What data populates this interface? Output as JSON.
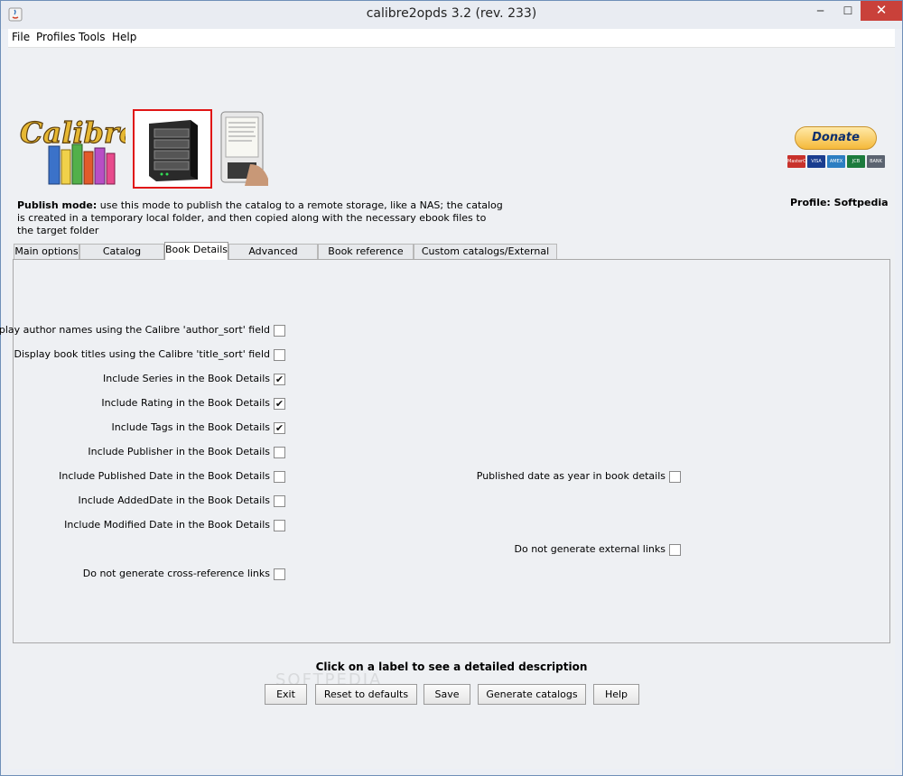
{
  "window": {
    "title": "calibre2opds 3.2 (rev. 233)",
    "minimize": "─",
    "maximize": "☐",
    "close": "✕"
  },
  "menu": [
    "File",
    "Profiles",
    "Tools",
    "Help"
  ],
  "header": {
    "logo_text": "Calibre",
    "donate": "Donate",
    "cards": [
      "MasterCard",
      "VISA",
      "AMEX",
      "JCB",
      "BANK"
    ],
    "profile": "Profile: Softpedia",
    "publish_mode_label": "Publish mode:",
    "publish_mode_text": "use this mode to publish the catalog to a remote storage, like a NAS; the catalog is created in a temporary local folder, and then copied along with the necessary ebook files to the target folder"
  },
  "tabs": [
    "Main options",
    "Catalog Structure",
    "Book Details",
    "Advanced Options",
    "Book reference links",
    "Custom catalogs/External Links"
  ],
  "active_tab": "Book Details",
  "options_left": [
    {
      "label": "Display author names using the Calibre 'author_sort' field",
      "checked": false
    },
    {
      "label": "Display book titles using the Calibre 'title_sort' field",
      "checked": false
    },
    {
      "label": "Include Series in the Book Details",
      "checked": true
    },
    {
      "label": "Include Rating in the Book Details",
      "checked": true
    },
    {
      "label": "Include Tags in the Book Details",
      "checked": true
    },
    {
      "label": "Include Publisher in the Book Details",
      "checked": false
    },
    {
      "label": "Include Published Date in the Book Details",
      "checked": false
    },
    {
      "label": "Include AddedDate in the Book Details",
      "checked": false
    },
    {
      "label": "Include Modified Date in the Book Details",
      "checked": false
    },
    {
      "label": "Do not generate cross-reference links",
      "checked": false
    }
  ],
  "options_right": [
    {
      "label": "Published date as year in book details",
      "checked": false
    },
    {
      "label": "Do not generate external links",
      "checked": false
    }
  ],
  "check_mark": "✔",
  "hint": "Click on a label to see a detailed description",
  "buttons": [
    "Exit",
    "Reset to defaults",
    "Save",
    "Generate catalogs",
    "Help"
  ],
  "watermark": "SOFTPEDIA"
}
